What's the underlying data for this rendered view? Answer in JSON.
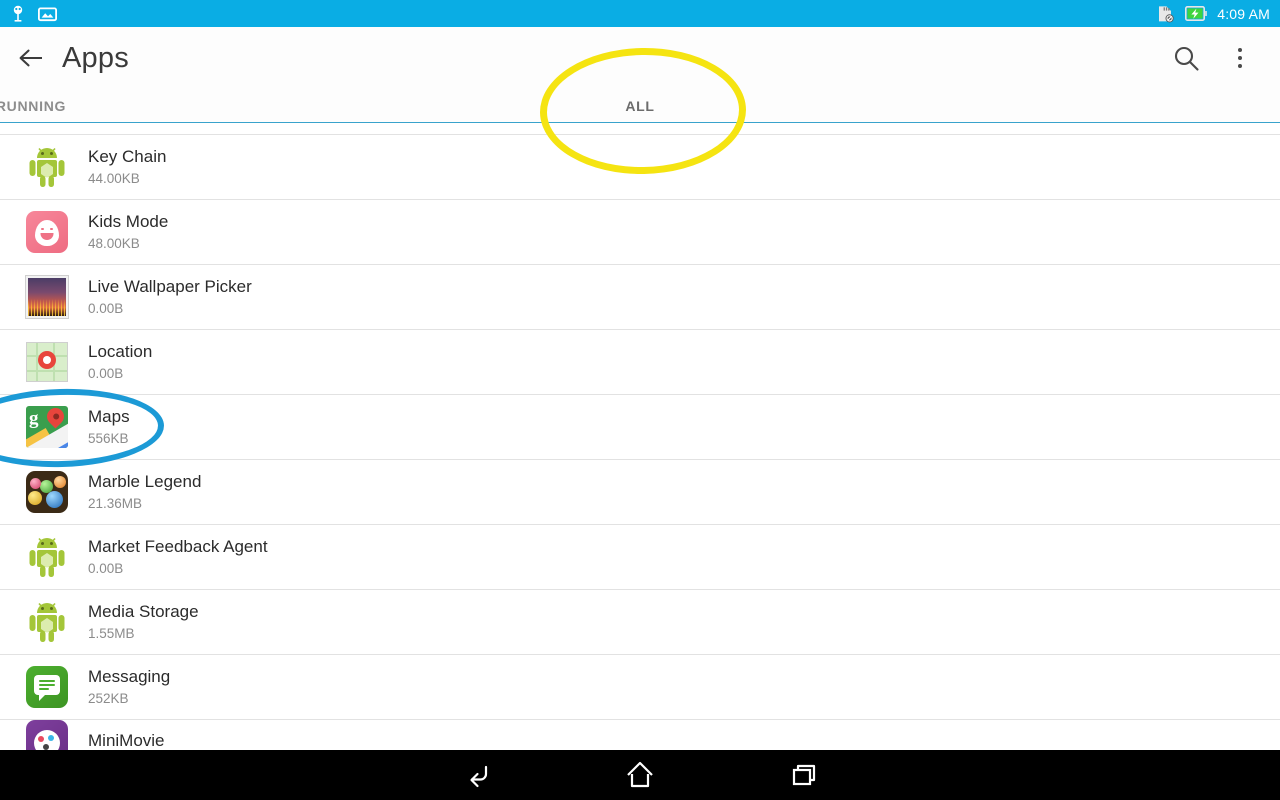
{
  "status_bar": {
    "background": "#0aade4",
    "time": "4:09 AM",
    "left_icons": [
      {
        "name": "usb-debug-icon",
        "label": "USB debugging"
      },
      {
        "name": "screenshot-icon",
        "label": "Screenshot captured"
      }
    ],
    "right_icons": [
      {
        "name": "sd-card-disabled-icon",
        "label": "SD card removed"
      },
      {
        "name": "battery-charging-icon",
        "label": "Battery charging"
      }
    ]
  },
  "action_bar": {
    "back_label": "Navigate up",
    "title": "Apps",
    "search_label": "Search",
    "overflow_label": "More options"
  },
  "tabs": {
    "items": [
      {
        "id": "running",
        "label": "RUNNING",
        "selected": false
      },
      {
        "id": "all",
        "label": "ALL",
        "selected": true
      }
    ],
    "indicator_color": "#19a0d8",
    "rule_color": "#39a3cc"
  },
  "app_list": [
    {
      "name": "Key Chain",
      "size": "44.00KB",
      "icon": "android-robot-icon"
    },
    {
      "name": "Kids Mode",
      "size": "48.00KB",
      "icon": "kids-mode-icon"
    },
    {
      "name": "Live Wallpaper Picker",
      "size": "0.00B",
      "icon": "live-wallpaper-icon"
    },
    {
      "name": "Location",
      "size": "0.00B",
      "icon": "location-map-icon"
    },
    {
      "name": "Maps",
      "size": "556KB",
      "icon": "google-maps-icon"
    },
    {
      "name": "Marble Legend",
      "size": "21.36MB",
      "icon": "marble-legend-icon"
    },
    {
      "name": "Market Feedback Agent",
      "size": "0.00B",
      "icon": "android-robot-icon"
    },
    {
      "name": "Media Storage",
      "size": "1.55MB",
      "icon": "android-robot-icon"
    },
    {
      "name": "Messaging",
      "size": "252KB",
      "icon": "messaging-icon"
    },
    {
      "name": "MiniMovie",
      "size": "",
      "icon": "minimovie-icon"
    }
  ],
  "annotations": [
    {
      "id": "all-tab-highlight",
      "shape": "ellipse",
      "color": "#f5e411",
      "target": "ALL"
    },
    {
      "id": "maps-row-highlight",
      "shape": "ellipse",
      "color": "#1c9ad6",
      "target": "Maps"
    }
  ],
  "nav_bar": {
    "background": "#000000",
    "buttons": [
      {
        "id": "back",
        "label": "Back",
        "icon": "back-arrow-icon"
      },
      {
        "id": "home",
        "label": "Home",
        "icon": "home-icon"
      },
      {
        "id": "recents",
        "label": "Recent apps",
        "icon": "recents-icon"
      }
    ]
  }
}
